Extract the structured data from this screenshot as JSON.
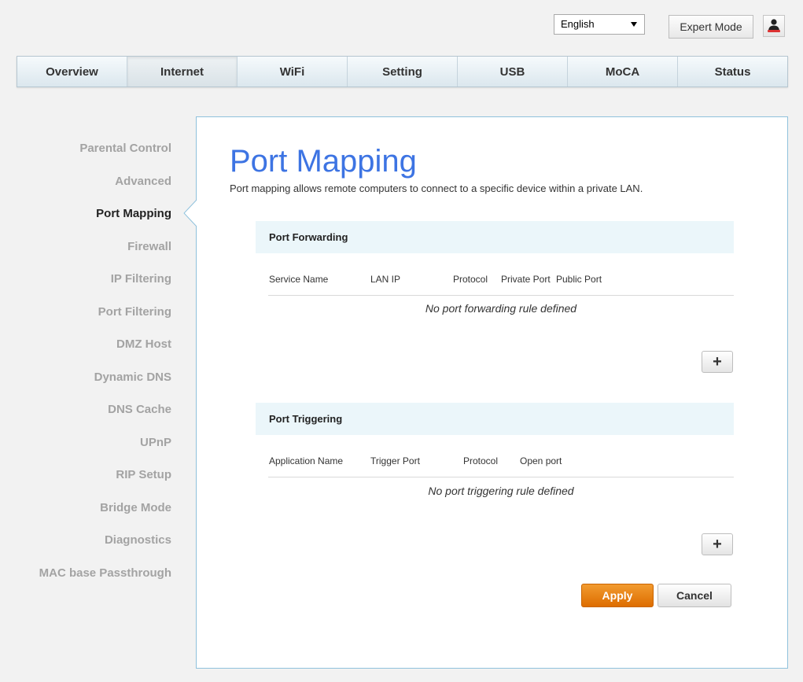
{
  "header": {
    "language": "English",
    "expert_mode_label": "Expert Mode",
    "user_icon": "user-icon"
  },
  "nav": {
    "tabs": [
      {
        "label": "Overview"
      },
      {
        "label": "Internet"
      },
      {
        "label": "WiFi"
      },
      {
        "label": "Setting"
      },
      {
        "label": "USB"
      },
      {
        "label": "MoCA"
      },
      {
        "label": "Status"
      }
    ],
    "active": "Internet"
  },
  "sidebar": {
    "items": [
      {
        "label": "Parental Control"
      },
      {
        "label": "Advanced"
      },
      {
        "label": "Port Mapping"
      },
      {
        "label": "Firewall"
      },
      {
        "label": "IP Filtering"
      },
      {
        "label": "Port Filtering"
      },
      {
        "label": "DMZ Host"
      },
      {
        "label": "Dynamic DNS"
      },
      {
        "label": "DNS Cache"
      },
      {
        "label": "UPnP"
      },
      {
        "label": "RIP Setup"
      },
      {
        "label": "Bridge Mode"
      },
      {
        "label": "Diagnostics"
      },
      {
        "label": "MAC base Passthrough"
      }
    ],
    "active": "Port Mapping"
  },
  "main": {
    "title": "Port Mapping",
    "description": "Port mapping allows remote computers to connect to a specific device within a private LAN.",
    "port_forwarding": {
      "heading": "Port Forwarding",
      "columns": [
        "Service Name",
        "LAN IP",
        "Protocol",
        "Private Port",
        "Public Port"
      ],
      "empty_message": "No port forwarding rule defined",
      "add_label": "+"
    },
    "port_triggering": {
      "heading": "Port Triggering",
      "columns": [
        "Application Name",
        "Trigger Port",
        "Protocol",
        "Open port"
      ],
      "empty_message": "No port triggering rule defined",
      "add_label": "+"
    },
    "apply_label": "Apply",
    "cancel_label": "Cancel"
  },
  "colors": {
    "accent_title": "#3d74e3",
    "apply_button": "#e77e12",
    "panel_border": "#8fc1dc",
    "section_bg": "#ebf6fa"
  }
}
